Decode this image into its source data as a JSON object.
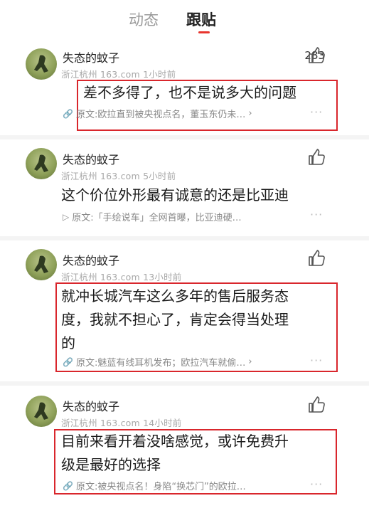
{
  "tabs": {
    "dynamic": "动态",
    "reply": "跟贴"
  },
  "posts": [
    {
      "username": "失态的蚊子",
      "meta": "浙江杭州  163.com  1小时前",
      "likes": "283",
      "content": "差不多得了，也不是说多大的问题",
      "quote_icon": "🔗",
      "quote": "原文:欧拉直到被央视点名，董玉东仍未…",
      "quote_arrow": "›",
      "more": "···"
    },
    {
      "username": "失态的蚊子",
      "meta": "浙江杭州  163.com  5小时前",
      "likes": "",
      "content": "这个价位外形最有诚意的还是比亚迪",
      "quote_icon": "▷",
      "quote": "原文:「手绘说车」全网首曝，比亚迪硬…",
      "quote_arrow": "",
      "more": "···"
    },
    {
      "username": "失态的蚊子",
      "meta": "浙江杭州  163.com  13小时前",
      "likes": "",
      "content_lines": [
        "就冲长城汽车这么多年的售后服务态",
        "度，我就不担心了，肯定会得当处理",
        "的"
      ],
      "quote_icon": "🔗",
      "quote": "原文:魅蓝有线耳机发布；欧拉汽车就偷…",
      "quote_arrow": "›",
      "more": "···"
    },
    {
      "username": "失态的蚊子",
      "meta": "浙江杭州  163.com  14小时前",
      "likes": "",
      "content_lines": [
        "目前来看开着没啥感觉，或许免费升",
        "级是最好的选择"
      ],
      "quote_icon": "🔗",
      "quote": "原文:被央视点名！身陷“换芯门”的欧拉…",
      "quote_arrow": "",
      "more": "···"
    }
  ]
}
